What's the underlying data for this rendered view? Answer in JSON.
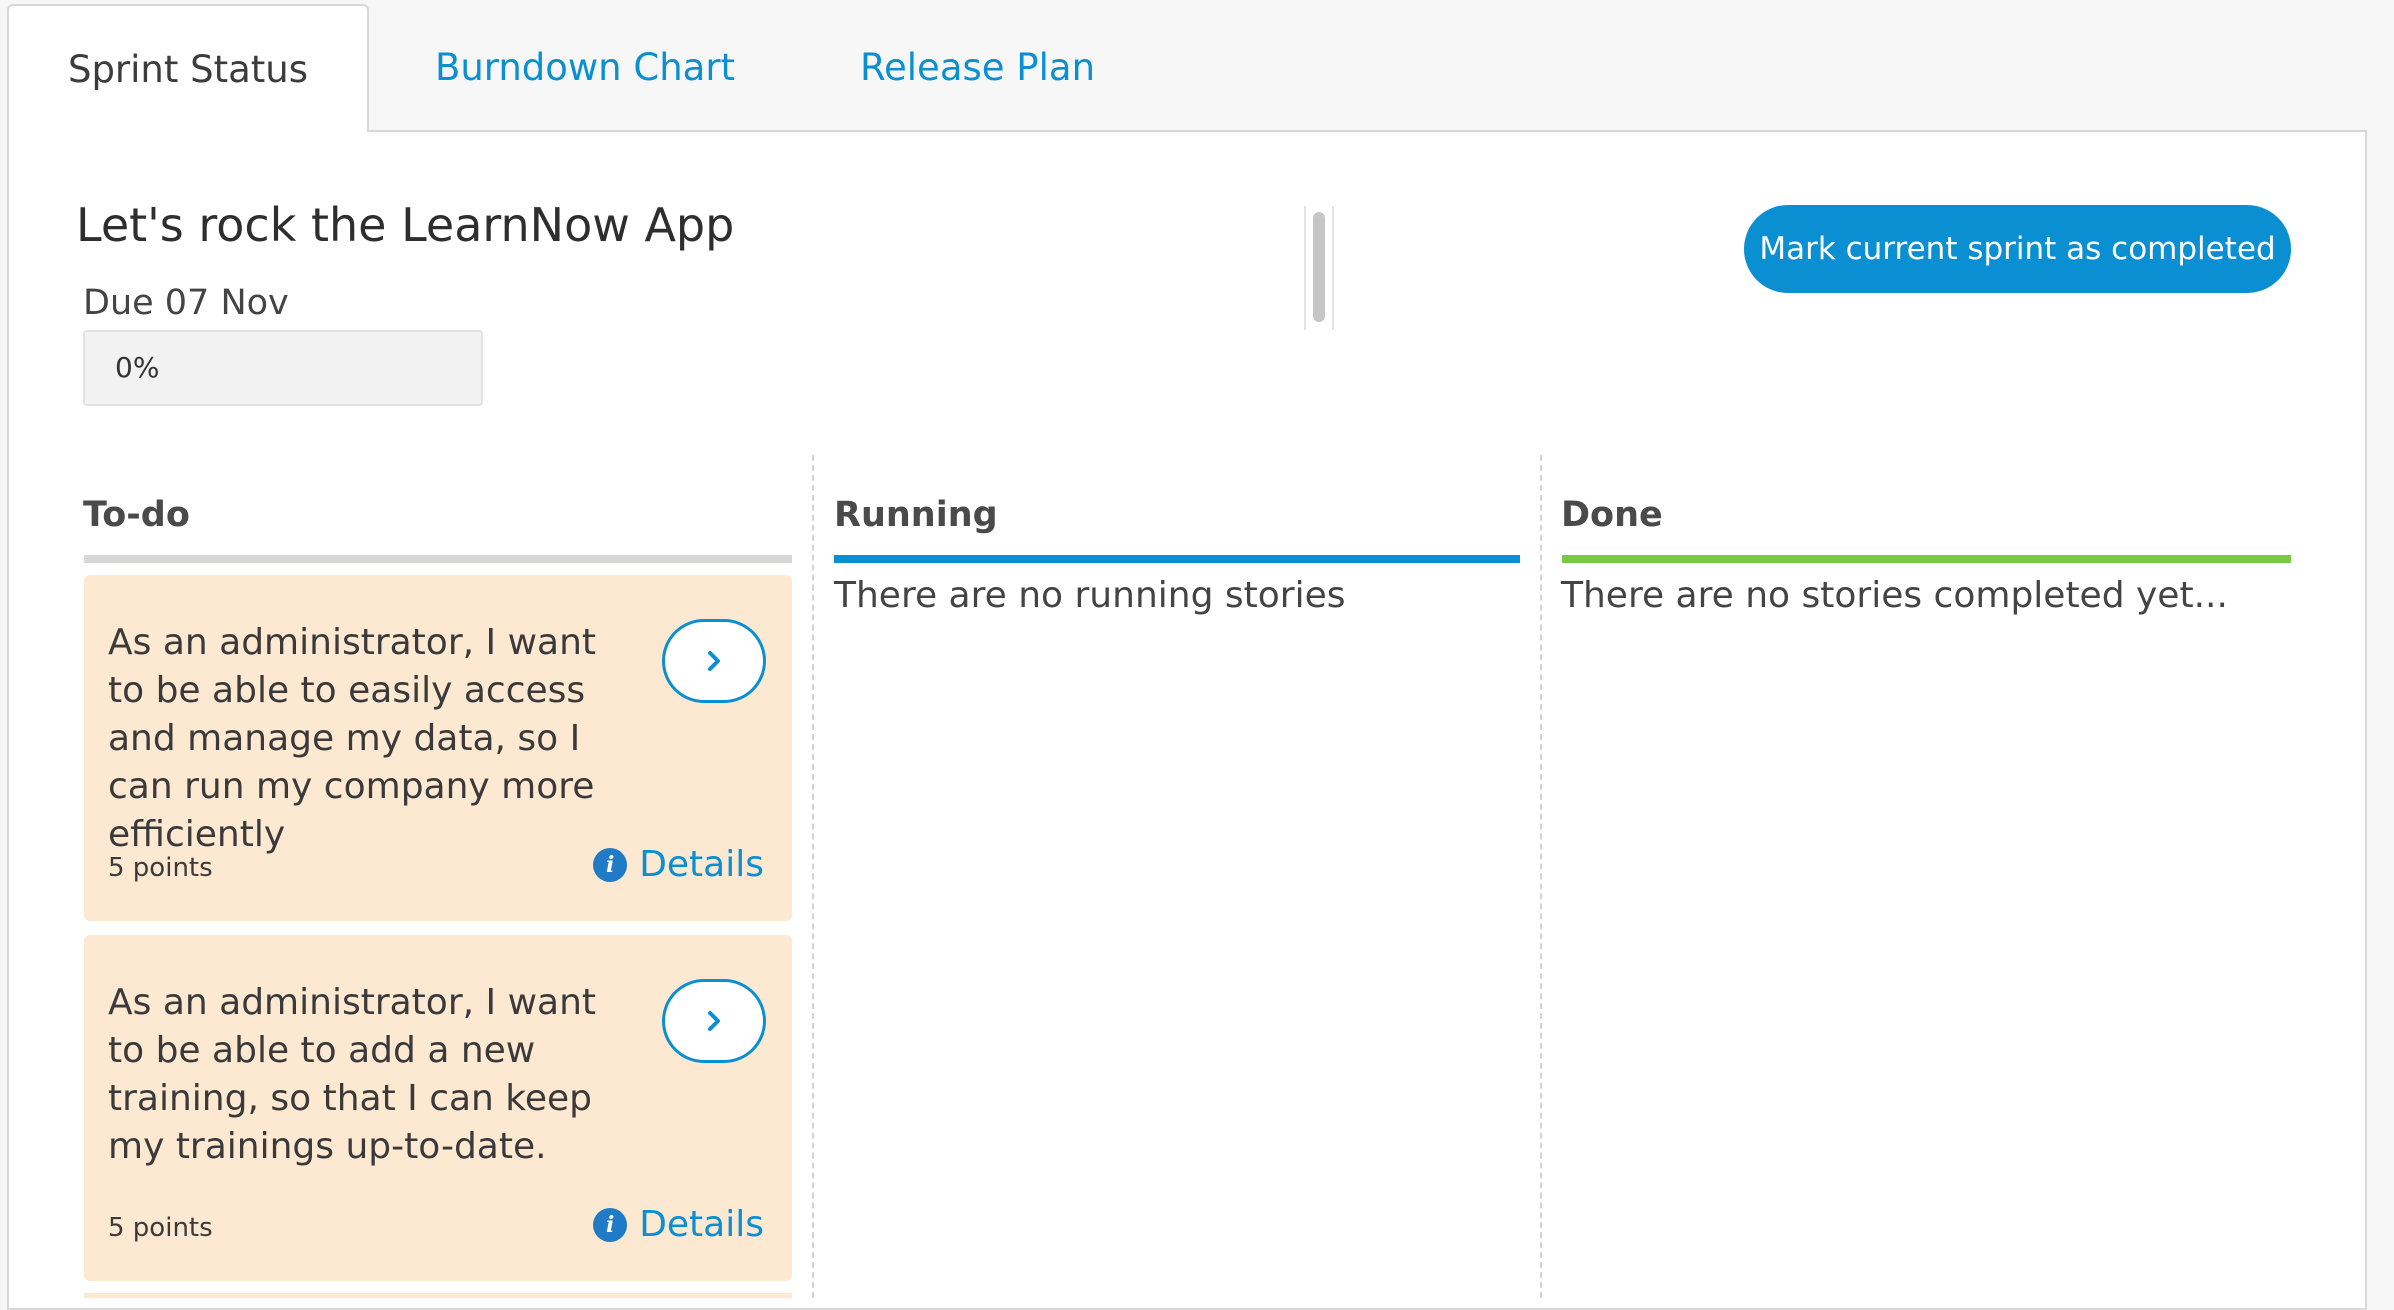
{
  "tabs": [
    {
      "label": "Sprint Status",
      "active": true
    },
    {
      "label": "Burndown Chart",
      "active": false
    },
    {
      "label": "Release Plan",
      "active": false
    }
  ],
  "sprint": {
    "title": "Let's rock the LearnNow App",
    "due": "Due 07 Nov",
    "progress_label": "0%",
    "progress_fraction": 0,
    "complete_button": "Mark current sprint as completed"
  },
  "columns": {
    "todo": {
      "title": "To-do",
      "color": "#d8d8d8"
    },
    "running": {
      "title": "Running",
      "color": "#0a8fd3",
      "empty_text": "There are no running stories"
    },
    "done": {
      "title": "Done",
      "color": "#7ac943",
      "empty_text": "There are no stories completed yet..."
    }
  },
  "cards": [
    {
      "text": "As an administrator, I want to be able to easily access and manage my data, so I can run my company more efficiently",
      "points": "5 points",
      "details_label": "Details"
    },
    {
      "text": "As an administrator, I want to be able to add a new training, so that I can keep my trainings up-to-date.",
      "points": "5 points",
      "details_label": "Details"
    }
  ],
  "colors": {
    "accent": "#0a8fd3",
    "card_bg": "#fde8d2"
  }
}
